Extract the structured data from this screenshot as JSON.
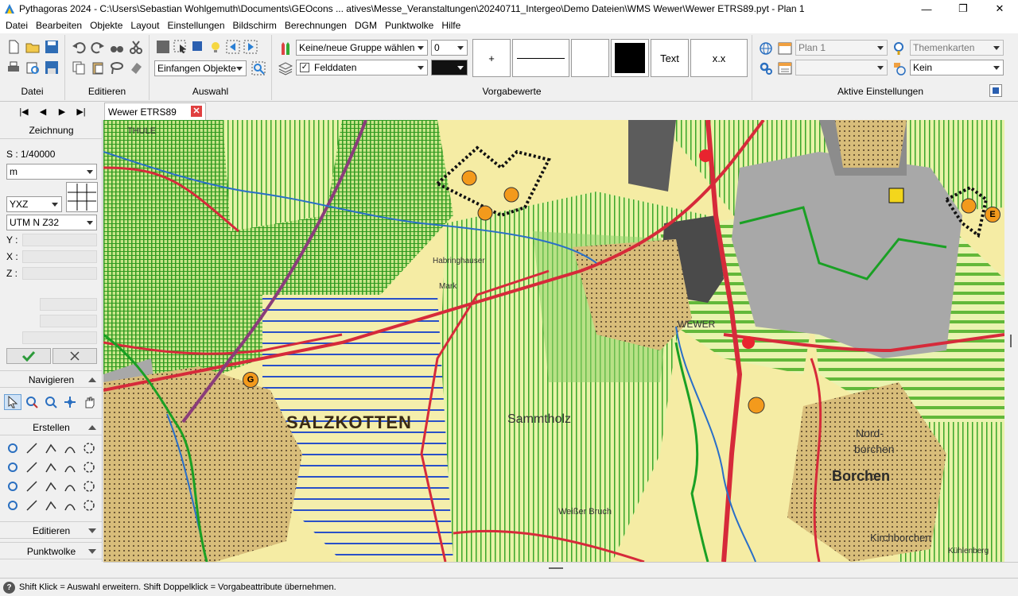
{
  "titlebar": {
    "title": "Pythagoras 2024 - C:\\Users\\Sebastian Wohlgemuth\\Documents\\GEOcons ... atives\\Messe_Veranstaltungen\\20240711_Intergeo\\Demo Dateien\\WMS Wewer\\Wewer ETRS89.pyt - Plan 1",
    "minimize": "—",
    "maximize": "❐",
    "close": "✕"
  },
  "menu": [
    "Datei",
    "Bearbeiten",
    "Objekte",
    "Layout",
    "Einstellungen",
    "Bildschirm",
    "Berechnungen",
    "DGM",
    "Punktwolke",
    "Hilfe"
  ],
  "ribbon": {
    "groups": {
      "datei": "Datei",
      "editieren": "Editieren",
      "auswahl": "Auswahl",
      "vorgabewerte": "Vorgabewerte",
      "aktive": "Aktive Einstellungen"
    },
    "capture_combo": "Einfangen Objekte",
    "group_combo": "Keine/neue Gruppe wählen",
    "layer_combo": "Felddaten",
    "layer_checked": true,
    "number_combo": "0",
    "color_hex": "#111111",
    "btn_plus": "+",
    "btn_text": "Text",
    "btn_xx": "x.x",
    "plan_combo": "Plan 1",
    "plan_combo2": "",
    "theme_combo": "Themenkarten",
    "kein_combo": "Kein"
  },
  "nav": {
    "first": "|◀",
    "prev": "◀",
    "next": "▶",
    "last": "▶|"
  },
  "tab": {
    "label": "Wewer ETRS89",
    "close": "✕"
  },
  "left": {
    "zeichnung": "Zeichnung",
    "scale": "S : 1/40000",
    "unit": "m",
    "axis": "YXZ",
    "crs": "UTM N Z32",
    "y_label": "Y :",
    "x_label": "X :",
    "z_label": "Z :",
    "navigieren": "Navigieren",
    "erstellen": "Erstellen",
    "editieren": "Editieren",
    "punktwolke": "Punktwolke"
  },
  "map": {
    "labels": {
      "salzkotten": "SALZKOTTEN",
      "sammtholz": "Sammtholz",
      "wewer": "WEWER",
      "borchen": "Borchen",
      "nordborchen1": "Nord-",
      "nordborchen2": "borchen",
      "kirchborchen": "Kirchborchen",
      "weisserbruch": "Weißer Bruch",
      "thule": "THULE",
      "mark": "Mark",
      "habringhauser": "Habringhauser",
      "kuhlenberg": "Kühlenberg"
    },
    "markers": {
      "g": "G",
      "e": "E"
    }
  },
  "status": {
    "icon": "?",
    "text": "Shift Klick = Auswahl erweitern. Shift Doppelklick = Vorgabeattribute übernehmen."
  }
}
